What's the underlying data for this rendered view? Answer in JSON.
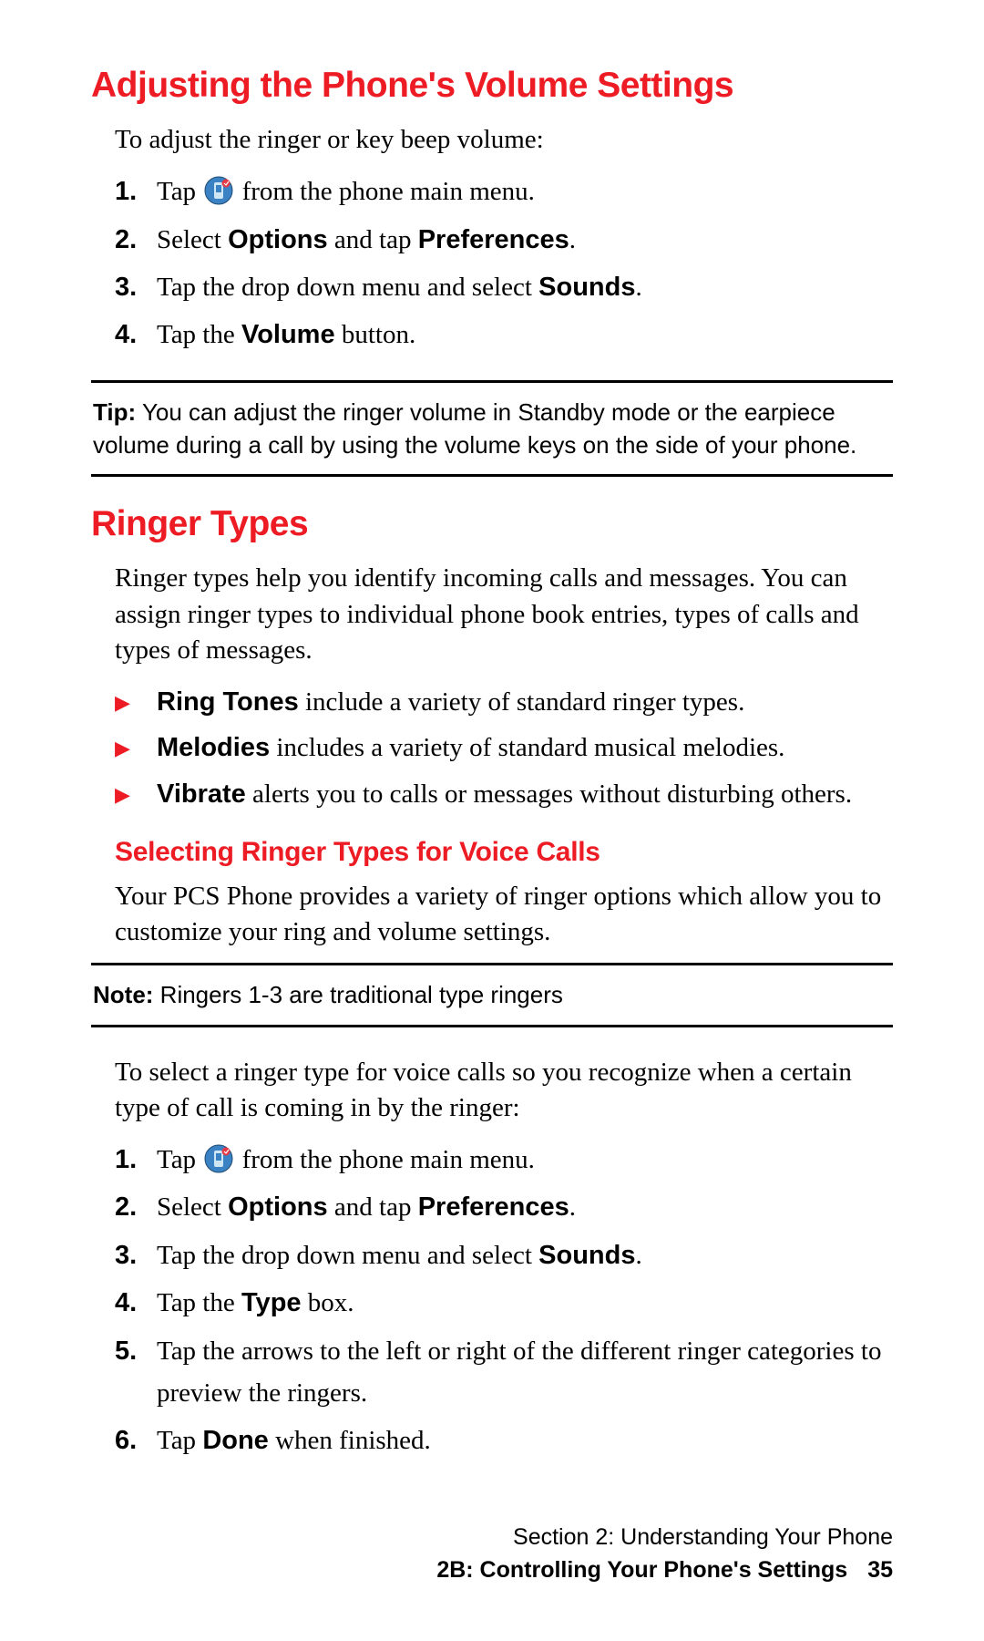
{
  "section1": {
    "heading": "Adjusting the Phone's Volume Settings",
    "intro": "To adjust the ringer or key beep volume:",
    "steps": [
      {
        "num": "1.",
        "pre": "Tap ",
        "icon": "phone-app-icon",
        "post": " from the phone main menu."
      },
      {
        "num": "2.",
        "parts": [
          "Select ",
          "Options",
          " and tap ",
          "Preferences",
          "."
        ]
      },
      {
        "num": "3.",
        "parts": [
          "Tap the drop down menu and select ",
          "Sounds",
          "."
        ]
      },
      {
        "num": "4.",
        "parts": [
          "Tap the ",
          "Volume",
          " button."
        ]
      }
    ],
    "tip_label": "Tip:",
    "tip_text": " You can adjust the ringer volume in Standby mode or the earpiece volume during a call by using the volume keys on the side of your phone."
  },
  "section2": {
    "heading": "Ringer Types",
    "intro": "Ringer types help you identify incoming calls and messages. You can assign ringer types to individual phone book entries, types of calls and types of messages.",
    "bullets": [
      {
        "bold": "Ring Tones",
        "rest": " include a variety of standard ringer types."
      },
      {
        "bold": "Melodies",
        "rest": " includes a variety of standard musical melodies."
      },
      {
        "bold": "Vibrate",
        "rest": " alerts you to calls or messages without disturbing others."
      }
    ],
    "sub_heading": "Selecting Ringer Types for Voice Calls",
    "sub_intro": "Your PCS Phone provides a variety of ringer options which allow you to customize your ring and volume settings.",
    "note_label": "Note:",
    "note_text": " Ringers 1-3 are traditional type ringers",
    "intro2": "To select a ringer type for voice calls so you recognize when a certain type of call is coming in by the ringer:",
    "steps": [
      {
        "num": "1.",
        "pre": "Tap ",
        "icon": "phone-app-icon",
        "post": " from the phone main menu."
      },
      {
        "num": "2.",
        "parts": [
          "Select ",
          "Options",
          " and tap ",
          "Preferences",
          "."
        ]
      },
      {
        "num": "3.",
        "parts": [
          "Tap the drop down menu and select ",
          "Sounds",
          "."
        ]
      },
      {
        "num": "4.",
        "parts": [
          "Tap the ",
          "Type",
          " box."
        ]
      },
      {
        "num": "5.",
        "parts": [
          "Tap the arrows to the left or right of the different ringer categories to preview the ringers."
        ]
      },
      {
        "num": "6.",
        "parts": [
          "Tap ",
          "Done",
          " when finished."
        ]
      }
    ]
  },
  "footer": {
    "line1": "Section 2: Understanding Your Phone",
    "line2": "2B: Controlling Your Phone's Settings",
    "page": "35"
  }
}
